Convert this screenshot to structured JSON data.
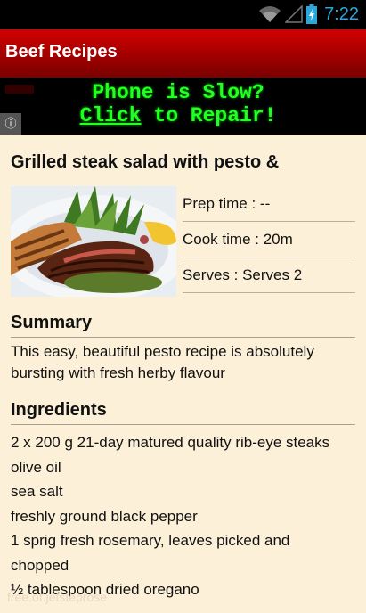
{
  "status_bar": {
    "time": "7:22",
    "icons": [
      "wifi-icon",
      "signal-icon",
      "battery-charging-icon"
    ],
    "time_color": "#2aa8dc"
  },
  "app_bar": {
    "title": "Beef Recipes",
    "color": "#b80000"
  },
  "ad": {
    "line1": "Phone is Slow?",
    "line2_link": "Click",
    "line2_rest": " to Repair!",
    "info_icon": "info-icon",
    "text_color": "#22ff22"
  },
  "recipe": {
    "title": "Grilled steak salad with pesto &",
    "image_alt": "grilled-steak-salad-photo",
    "prep": "Prep time : --",
    "cook": "Cook time : 20m",
    "serves": "Serves : Serves 2"
  },
  "summary": {
    "heading": "Summary",
    "text": "This easy, beautiful pesto recipe is absolutely bursting with fresh herby flavour"
  },
  "ingredients": {
    "heading": "Ingredients",
    "items": [
      "2 x 200 g 21-day matured quality rib-eye steaks",
      "olive oil",
      "sea salt",
      "freshly ground black pepper",
      "1 sprig fresh rosemary, leaves picked and",
      "chopped",
      "½ tablespoon dried oregano"
    ]
  },
  "watermark": "free.of.jetsteprose"
}
